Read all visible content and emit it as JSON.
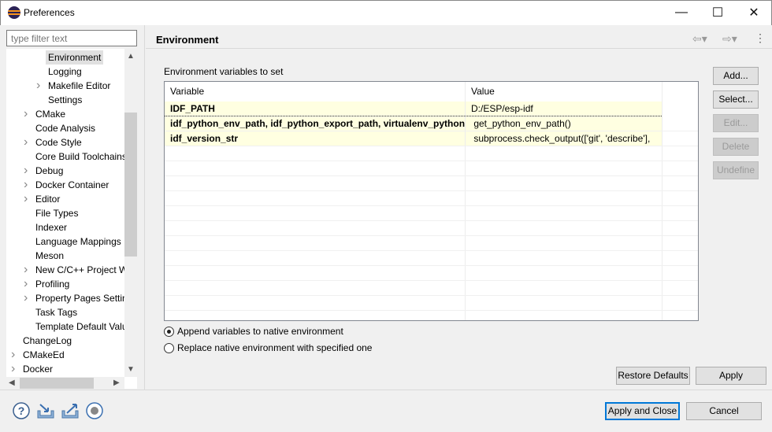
{
  "window": {
    "title": "Preferences",
    "minimize": "—",
    "maximize": "☐",
    "close": "✕"
  },
  "filter": {
    "placeholder": "type filter text"
  },
  "tree": [
    {
      "label": "Environment",
      "level": 3,
      "selected": true
    },
    {
      "label": "Logging",
      "level": 3
    },
    {
      "label": "Makefile Editor",
      "level": 3,
      "expandable": true
    },
    {
      "label": "Settings",
      "level": 3
    },
    {
      "label": "CMake",
      "level": 2,
      "expandable": true
    },
    {
      "label": "Code Analysis",
      "level": 2
    },
    {
      "label": "Code Style",
      "level": 2,
      "expandable": true
    },
    {
      "label": "Core Build Toolchains",
      "level": 2
    },
    {
      "label": "Debug",
      "level": 2,
      "expandable": true
    },
    {
      "label": "Docker Container",
      "level": 2,
      "expandable": true
    },
    {
      "label": "Editor",
      "level": 2,
      "expandable": true
    },
    {
      "label": "File Types",
      "level": 2
    },
    {
      "label": "Indexer",
      "level": 2
    },
    {
      "label": "Language Mappings",
      "level": 2
    },
    {
      "label": "Meson",
      "level": 2
    },
    {
      "label": "New C/C++ Project W",
      "level": 2,
      "expandable": true
    },
    {
      "label": "Profiling",
      "level": 2,
      "expandable": true
    },
    {
      "label": "Property Pages Settin",
      "level": 2,
      "expandable": true
    },
    {
      "label": "Task Tags",
      "level": 2
    },
    {
      "label": "Template Default Valu",
      "level": 2
    },
    {
      "label": "ChangeLog",
      "level": 1
    },
    {
      "label": "CMakeEd",
      "level": 1,
      "expandable": true
    },
    {
      "label": "Docker",
      "level": 1,
      "expandable": true
    }
  ],
  "page": {
    "title": "Environment",
    "vars_label": "Environment variables to set"
  },
  "table": {
    "columns": [
      "Variable",
      "Value"
    ],
    "rows": [
      {
        "variable": "IDF_PATH",
        "value": "D:/ESP/esp-idf"
      },
      {
        "variable": "idf_python_env_path, idf_python_export_path, virtualenv_python",
        "value": " get_python_env_path()"
      },
      {
        "variable": "idf_version_str",
        "value": " subprocess.check_output(['git', 'describe'],"
      }
    ]
  },
  "side_buttons": [
    {
      "label": "Add...",
      "enabled": true
    },
    {
      "label": "Select...",
      "enabled": true
    },
    {
      "label": "Edit...",
      "enabled": false
    },
    {
      "label": "Delete",
      "enabled": false
    },
    {
      "label": "Undefine",
      "enabled": false
    }
  ],
  "radios": [
    {
      "label": "Append variables to native environment",
      "checked": true
    },
    {
      "label": "Replace native environment with specified one",
      "checked": false
    }
  ],
  "buttons": {
    "restore": "Restore Defaults",
    "apply": "Apply",
    "apply_close": "Apply and Close",
    "cancel": "Cancel"
  },
  "colors": {
    "row_highlight": "#ffffe1",
    "accent": "#0078d7"
  }
}
